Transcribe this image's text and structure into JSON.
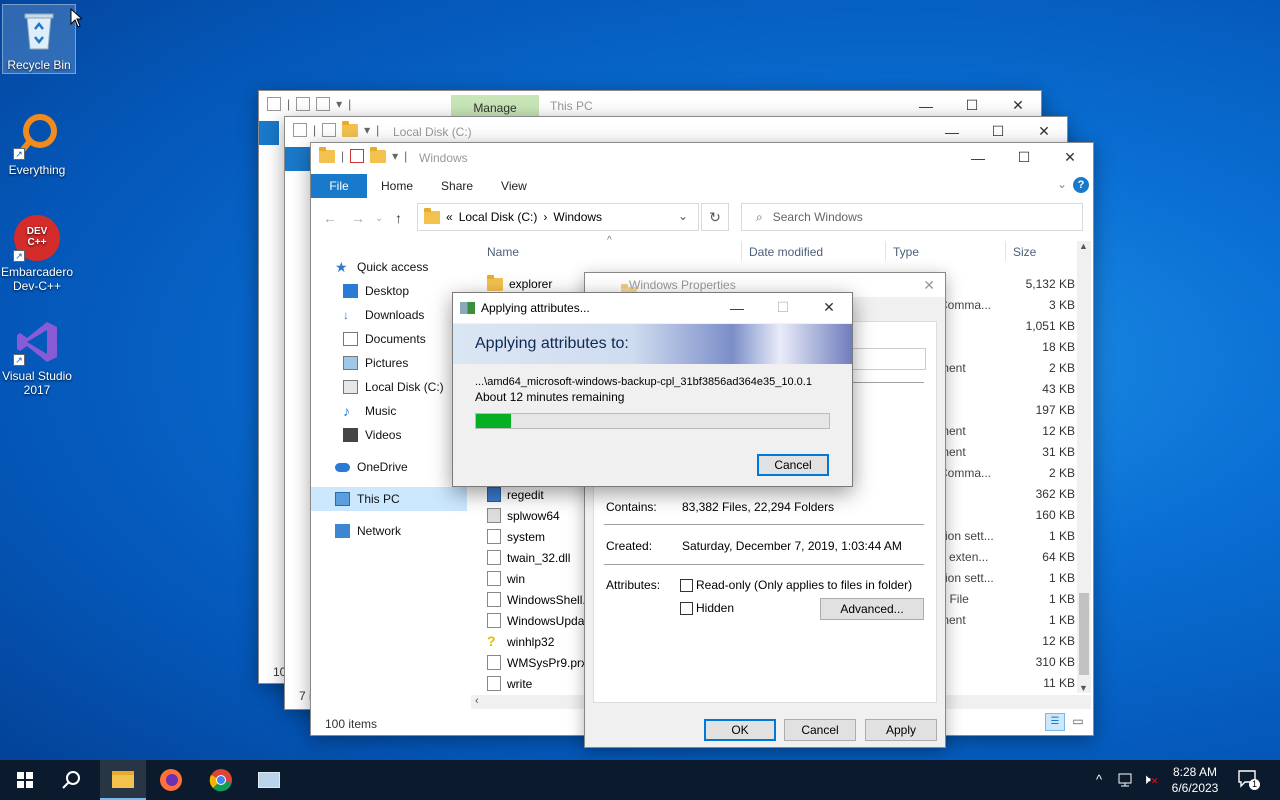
{
  "desktop": {
    "icons": [
      {
        "label": "Recycle Bin"
      },
      {
        "label": "Everything"
      },
      {
        "label": "Embarcadero Dev-C++"
      },
      {
        "label": "Visual Studio 2017"
      }
    ],
    "devcpp_logo": "DEV C++"
  },
  "back_window_1": {
    "manage_tab": "Manage",
    "title": "This PC",
    "status_prefix": "10"
  },
  "back_window_2": {
    "title": "Local Disk (C:)",
    "status_prefix": "7 i"
  },
  "explorer": {
    "title": "Windows",
    "ribbon": {
      "file": "File",
      "tabs": [
        "Home",
        "Share",
        "View"
      ]
    },
    "address": {
      "prefix": "«",
      "path": [
        "Local Disk (C:)",
        "Windows"
      ],
      "separator": "›"
    },
    "search_placeholder": "Search Windows",
    "sidebar": [
      {
        "label": "Quick access",
        "icon": "star-icon"
      },
      {
        "label": "Desktop",
        "icon": "desktop-icon"
      },
      {
        "label": "Downloads",
        "icon": "download-icon"
      },
      {
        "label": "Documents",
        "icon": "document-icon"
      },
      {
        "label": "Pictures",
        "icon": "picture-icon"
      },
      {
        "label": "Local Disk (C:)",
        "icon": "drive-icon"
      },
      {
        "label": "Music",
        "icon": "music-icon"
      },
      {
        "label": "Videos",
        "icon": "video-icon"
      },
      {
        "label": "OneDrive",
        "icon": "cloud-icon"
      },
      {
        "label": "This PC",
        "icon": "computer-icon"
      },
      {
        "label": "Network",
        "icon": "network-icon"
      }
    ],
    "columns": {
      "name": "Name",
      "date": "Date modified",
      "type": "Type",
      "size": "Size"
    },
    "files": [
      {
        "name": "explorer"
      },
      {
        "name": "regedit"
      },
      {
        "name": "splwow64"
      },
      {
        "name": "system"
      },
      {
        "name": "twain_32.dll"
      },
      {
        "name": "win"
      },
      {
        "name": "WindowsShell."
      },
      {
        "name": "WindowsUpda"
      },
      {
        "name": "winhlp32"
      },
      {
        "name": "WMSysPr9.prx"
      },
      {
        "name": "write"
      }
    ],
    "type_fragments": [
      "n",
      "Comma...",
      "n",
      "n",
      "ment",
      "n",
      "n",
      "ment",
      "ment",
      "Comma...",
      "n",
      "n",
      "ition sett...",
      "n exten...",
      "ition sett...",
      "T File",
      "ment",
      "n",
      "n",
      "n"
    ],
    "sizes": [
      "5,132 KB",
      "3 KB",
      "1,051 KB",
      "18 KB",
      "2 KB",
      "43 KB",
      "197 KB",
      "12 KB",
      "31 KB",
      "2 KB",
      "362 KB",
      "160 KB",
      "1 KB",
      "64 KB",
      "1 KB",
      "1 KB",
      "1 KB",
      "12 KB",
      "310 KB",
      "11 KB"
    ],
    "status": "100 items"
  },
  "properties": {
    "title": "Windows Properties",
    "contains_label": "Contains:",
    "contains_value": "83,382 Files, 22,294 Folders",
    "created_label": "Created:",
    "created_value": "Saturday, December 7, 2019, 1:03:44 AM",
    "attributes_label": "Attributes:",
    "readonly_label": "Read-only (Only applies to files in folder)",
    "hidden_label": "Hidden",
    "advanced_label": "Advanced...",
    "ok": "OK",
    "cancel": "Cancel",
    "apply": "Apply"
  },
  "applying": {
    "title": "Applying attributes...",
    "heading": "Applying attributes to:",
    "path": "...\\amd64_microsoft-windows-backup-cpl_31bf3856ad364e35_10.0.1",
    "remaining": "About 12 minutes remaining",
    "progress_fraction": 0.1,
    "cancel": "Cancel"
  },
  "taskbar": {
    "time": "8:28 AM",
    "date": "6/6/2023",
    "notification_count": "1"
  },
  "colors": {
    "accent": "#1979ca",
    "progress": "#06b025",
    "taskbar": "#0b1a2c"
  }
}
